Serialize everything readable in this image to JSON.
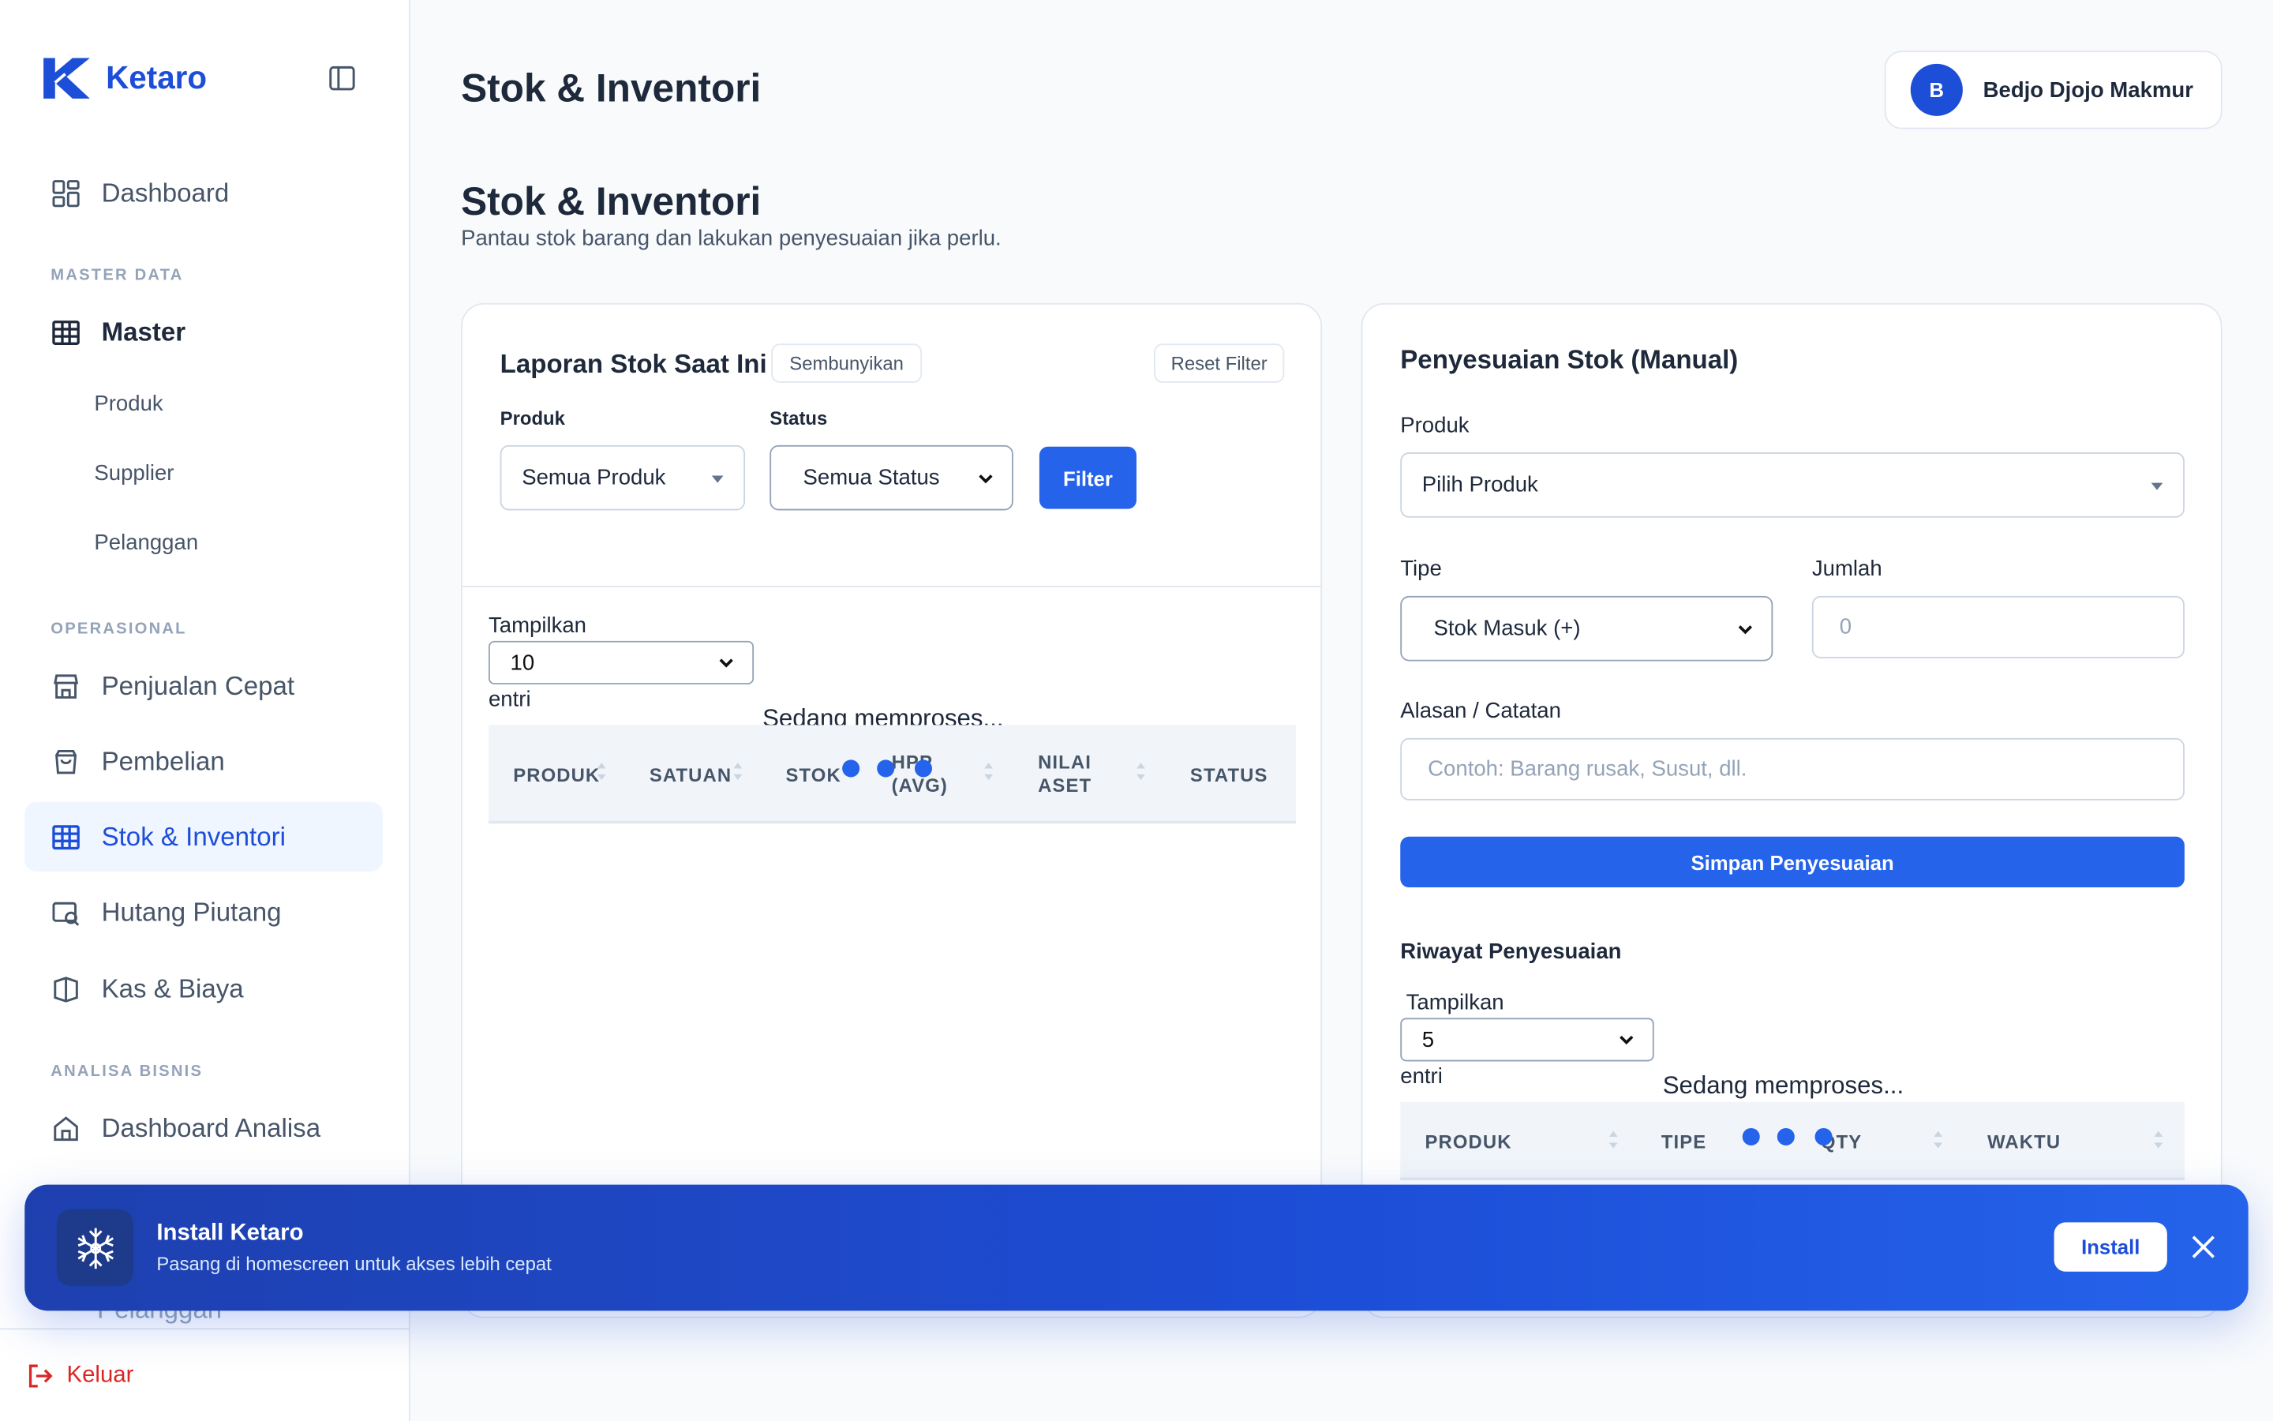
{
  "app": {
    "name": "Ketaro"
  },
  "sidebar": {
    "dashboard": "Dashboard",
    "section_master": "MASTER DATA",
    "master": "Master",
    "sub_items": [
      "Produk",
      "Supplier",
      "Pelanggan"
    ],
    "section_operasional": "OPERASIONAL",
    "operasional": [
      "Penjualan Cepat",
      "Pembelian",
      "Stok & Inventori",
      "Hutang Piutang",
      "Kas & Biaya"
    ],
    "active_item": "Stok & Inventori",
    "section_analisa": "ANALISA BISNIS",
    "analisa": [
      "Dashboard Analisa"
    ],
    "hidden_item": "Pelanggan",
    "logout": "Keluar"
  },
  "header": {
    "title": "Stok & Inventori",
    "user_initial": "B",
    "user_name": "Bedjo Djojo Makmur"
  },
  "main": {
    "title": "Stok & Inventori",
    "subtitle": "Pantau stok barang dan lakukan penyesuaian jika perlu."
  },
  "report": {
    "title": "Laporan Stok Saat Ini",
    "hide_label": "Sembunyikan",
    "reset_label": "Reset Filter",
    "product_label": "Produk",
    "product_value": "Semua Produk",
    "status_label": "Status",
    "status_value": "Semua Status",
    "filter_label": "Filter",
    "show_label": "Tampilkan",
    "page_size": "10",
    "entries_label": "entri",
    "processing": "Sedang memproses...",
    "columns": [
      "PRODUK",
      "SATUAN",
      "STOK",
      "HPP",
      "(AVG)",
      "NILAI",
      "ASET",
      "STATUS"
    ]
  },
  "adjust": {
    "title": "Penyesuaian Stok (Manual)",
    "product_label": "Produk",
    "product_placeholder": "Pilih Produk",
    "type_label": "Tipe",
    "type_value": "Stok Masuk (+)",
    "qty_label": "Jumlah",
    "qty_placeholder": "0",
    "reason_label": "Alasan / Catatan",
    "reason_placeholder": "Contoh: Barang rusak, Susut, dll.",
    "save_label": "Simpan Penyesuaian",
    "history_title": "Riwayat Penyesuaian",
    "show_label": "Tampilkan",
    "page_size": "5",
    "entries_label": "entri",
    "processing": "Sedang memproses...",
    "columns": [
      "PRODUK",
      "TIPE",
      "QTY",
      "WAKTU"
    ]
  },
  "banner": {
    "title": "Install Ketaro",
    "subtitle": "Pasang di homescreen untuk akses lebih cepat",
    "install_label": "Install"
  },
  "colors": {
    "primary": "#2563eb",
    "brand": "#1d4ed8",
    "danger": "#dc2626"
  }
}
